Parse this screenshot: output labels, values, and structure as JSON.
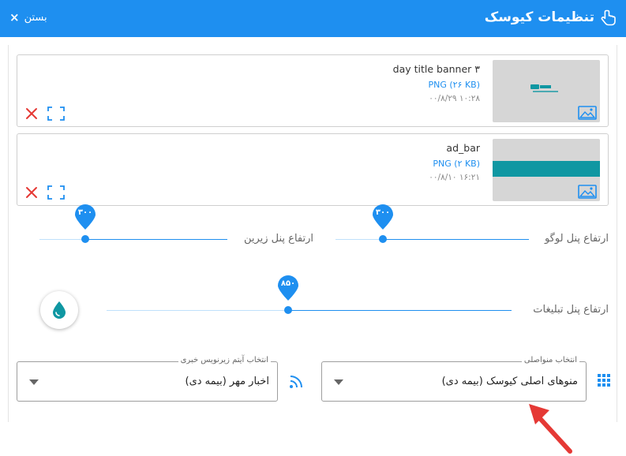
{
  "header": {
    "title": "تنظیمات کیوسک",
    "close_label": "بستن",
    "close_symbol": "×",
    "bg_color": "#1e8ff0"
  },
  "files": [
    {
      "name": "day title banner ۳",
      "size": "PNG (۲۶ KB)",
      "date": "۰۰/۸/۲۹ ۱۰:۲۸",
      "thumb_type": "logo-banner",
      "icons": [
        "image-icon",
        "delete-icon",
        "fullscreen-icon"
      ]
    },
    {
      "name": "ad_bar",
      "size": "PNG (۲ KB)",
      "date": "۰۰/۸/۱۰ ۱۶:۲۱",
      "thumb_type": "teal-bar",
      "icons": [
        "image-icon",
        "delete-icon",
        "fullscreen-icon"
      ]
    }
  ],
  "sliders": {
    "logo_panel": {
      "label": "ارتفاع پنل لوگو",
      "value": "۳۰۰",
      "fraction": 0.25
    },
    "bottom_panel": {
      "label": "ارتفاع پنل زیرین",
      "value": "۳۰۰",
      "fraction": 0.25
    },
    "ads_panel": {
      "label": "ارتفاع پنل تبلیغات",
      "value": "۸۵۰",
      "fraction": 0.45
    }
  },
  "theme_button": {
    "icon": "water-drop-icon",
    "color": "#0f97a2"
  },
  "selects": {
    "main_menu": {
      "legend": "انتخاب منواصلی",
      "value": "منوهای اصلی کیوسک (بیمه دی)",
      "icon": "grid-icon"
    },
    "news_ticker": {
      "legend": "انتخاب آیتم زیرنویس خبری",
      "value": "اخبار مهر (بیمه دی)",
      "icon": "rss-icon"
    }
  },
  "colors": {
    "accent": "#1e8ff0",
    "delete": "#e53935",
    "annotation_arrow": "#e53935"
  }
}
